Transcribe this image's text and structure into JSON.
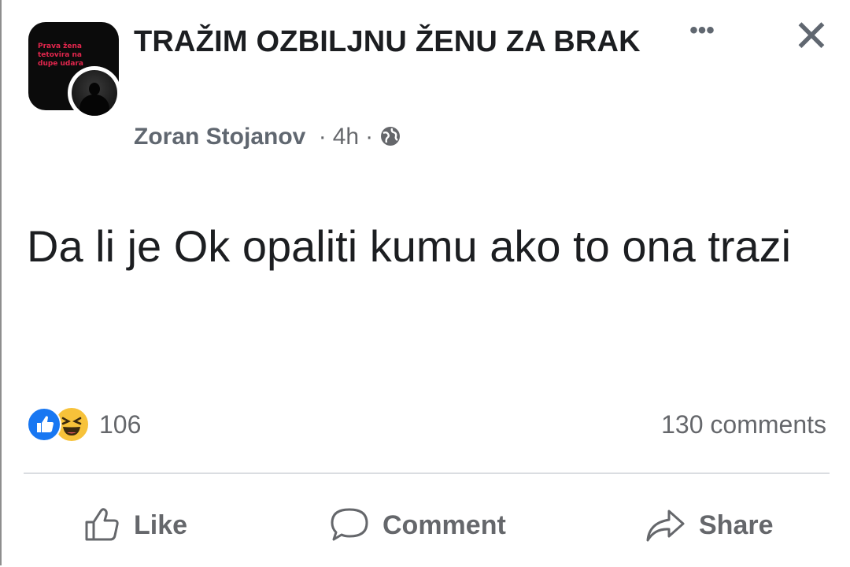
{
  "group": {
    "title": "TRAŽIM OZBILJNU ŽENU ZA BRAK",
    "avatar_text": "Prava žena tetovira na dupe udara"
  },
  "post": {
    "author": "Zoran Stojanov",
    "time": "4h",
    "separator": "·",
    "privacy_icon": "globe-icon",
    "text": "Da li je Ok opaliti kumu ako to ona trazi"
  },
  "header_actions": {
    "more": "•••",
    "close": "✕"
  },
  "stats": {
    "reaction_count": "106",
    "reactions": [
      "like-icon",
      "haha-icon"
    ],
    "comments": "130 comments"
  },
  "actions": {
    "like": "Like",
    "comment": "Comment",
    "share": "Share"
  },
  "colors": {
    "like_blue": "#1877f2",
    "haha_yellow": "#f7c23a",
    "secondary_text": "#65676b"
  }
}
